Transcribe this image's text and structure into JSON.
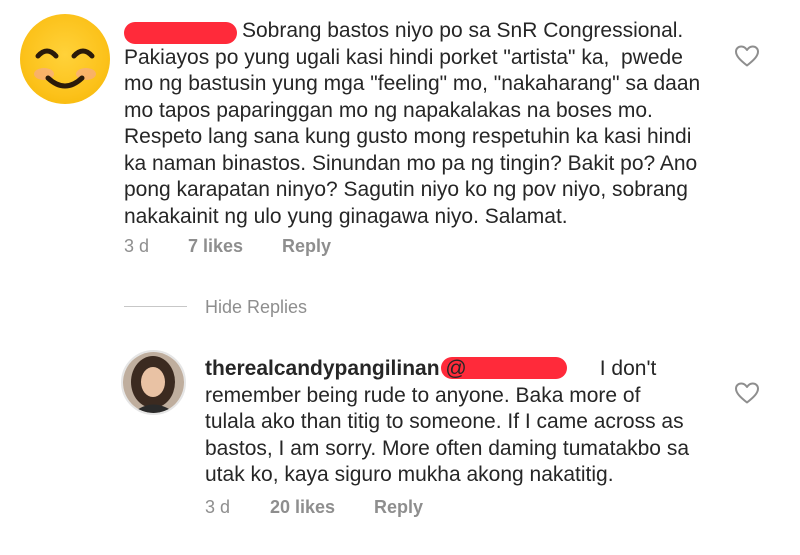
{
  "comment": {
    "lines": [
      "Sobrang bastos niyo po sa SnR Congressional.",
      "Pakiayos po yung ugali kasi hindi porket \"artista\" ka,  pwede",
      "mo ng bastusin yung mga \"feeling\" mo, \"nakaharang\" sa daan",
      "mo tapos paparinggan mo ng napakalakas na boses mo.",
      "Respeto lang sana kung gusto mong respetuhin ka kasi hindi",
      "ka naman binastos. Sinundan mo pa ng tingin? Bakit po? Ano",
      "pong karapatan ninyo? Sagutin niyo ko ng pov niyo, sobrang",
      "nakakainit ng ulo yung ginagawa niyo. Salamat."
    ],
    "time": "3 d",
    "likes": "7 likes",
    "reply": "Reply"
  },
  "hide_replies": "Hide Replies",
  "reply": {
    "username": "therealcandypangilinan",
    "mention_prefix": "@",
    "first_line_rest": "I don't",
    "lines": [
      "remember being rude to anyone. Baka more of",
      "tulala ako than titig to someone. If I came across as",
      "bastos, I am sorry. More often daming tumatakbo sa",
      "utak ko, kaya siguro mukha akong nakatitig."
    ],
    "time": "3 d",
    "likes": "20 likes",
    "reply": "Reply"
  },
  "colors": {
    "redaction": "#ff2a3a",
    "text": "#262626",
    "meta": "#8e8e8e"
  },
  "icons": {
    "avatar_1": "smiling-face-emoji",
    "like": "heart-outline-icon"
  }
}
